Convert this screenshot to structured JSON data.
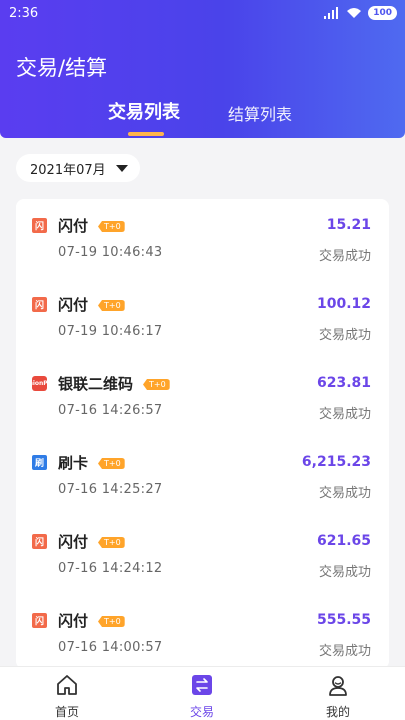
{
  "status_bar": {
    "time": "2:36",
    "battery": "100"
  },
  "header": {
    "title": "交易/结算"
  },
  "tabs": [
    {
      "label": "交易列表",
      "active": true
    },
    {
      "label": "结算列表",
      "active": false
    }
  ],
  "filter": {
    "month": "2021年07月"
  },
  "transactions": [
    {
      "type": "闪付",
      "icon_text": "闪",
      "icon": "flash-pay-icon",
      "badge": "T+0",
      "time": "07-19 10:46:43",
      "amount": "15.21",
      "status": "交易成功"
    },
    {
      "type": "闪付",
      "icon_text": "闪",
      "icon": "flash-pay-icon",
      "badge": "T+0",
      "time": "07-19 10:46:17",
      "amount": "100.12",
      "status": "交易成功"
    },
    {
      "type": "银联二维码",
      "icon_text": "UnionPay",
      "icon": "unionpay-icon",
      "badge": "T+0",
      "time": "07-16 14:26:57",
      "amount": "623.81",
      "status": "交易成功"
    },
    {
      "type": "刷卡",
      "icon_text": "刷",
      "icon": "card-swipe-icon",
      "badge": "T+0",
      "time": "07-16 14:25:27",
      "amount": "6,215.23",
      "status": "交易成功"
    },
    {
      "type": "闪付",
      "icon_text": "闪",
      "icon": "flash-pay-icon",
      "badge": "T+0",
      "time": "07-16 14:24:12",
      "amount": "621.65",
      "status": "交易成功"
    },
    {
      "type": "闪付",
      "icon_text": "闪",
      "icon": "flash-pay-icon",
      "badge": "T+0",
      "time": "07-16 14:00:57",
      "amount": "555.55",
      "status": "交易成功"
    }
  ],
  "bottom_nav": [
    {
      "label": "首页",
      "icon": "home-icon",
      "active": false
    },
    {
      "label": "交易",
      "icon": "transactions-icon",
      "active": true
    },
    {
      "label": "我的",
      "icon": "profile-icon",
      "active": false
    }
  ],
  "colors": {
    "accent": "#6b46e8",
    "header_start": "#5a3df0",
    "header_end": "#4f6af0",
    "badge": "#ffa42a"
  }
}
